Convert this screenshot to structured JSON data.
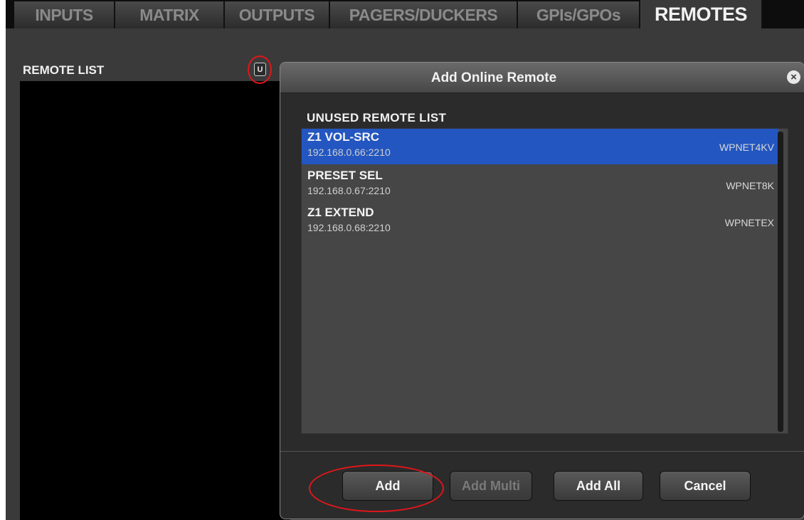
{
  "tabs": [
    {
      "label": "INPUTS",
      "active": false
    },
    {
      "label": "MATRIX",
      "active": false
    },
    {
      "label": "OUTPUTS",
      "active": false
    },
    {
      "label": "PAGERS/DUCKERS",
      "active": false
    },
    {
      "label": "GPIs/GPOs",
      "active": false
    },
    {
      "label": "REMOTES",
      "active": true
    }
  ],
  "left_panel": {
    "title": "REMOTE LIST",
    "u_button_label": "U"
  },
  "dialog": {
    "title": "Add Online Remote",
    "close_icon": "×",
    "list_title": "UNUSED REMOTE LIST",
    "items": [
      {
        "name": "Z1 VOL-SRC",
        "address": "192.168.0.66:2210",
        "model": "WPNET4KV",
        "selected": true
      },
      {
        "name": "PRESET SEL",
        "address": "192.168.0.67:2210",
        "model": "WPNET8K",
        "selected": false
      },
      {
        "name": "Z1 EXTEND",
        "address": "192.168.0.68:2210",
        "model": "WPNETEX",
        "selected": false
      }
    ],
    "buttons": {
      "add": "Add",
      "add_multi": "Add Multi",
      "add_all": "Add All",
      "cancel": "Cancel"
    }
  },
  "colors": {
    "selection": "#2356c0",
    "annotation_circle": "#e0161b"
  }
}
